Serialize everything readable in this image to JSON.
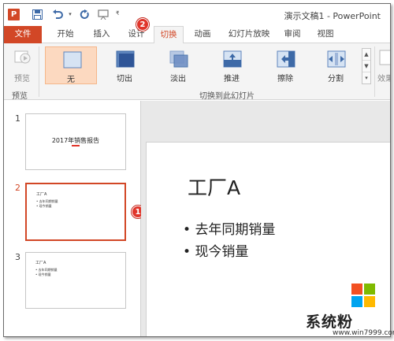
{
  "titlebar": {
    "app_icon": "P",
    "title": "演示文稿1 - PowerPoint",
    "qat": [
      "save-icon",
      "undo-icon",
      "redo-icon",
      "present-icon"
    ]
  },
  "tabs": [
    {
      "label": "文件",
      "active": false
    },
    {
      "label": "开始",
      "active": false
    },
    {
      "label": "插入",
      "active": false
    },
    {
      "label": "设计",
      "active": false
    },
    {
      "label": "切换",
      "active": true
    },
    {
      "label": "动画",
      "active": false
    },
    {
      "label": "幻灯片放映",
      "active": false
    },
    {
      "label": "审阅",
      "active": false
    },
    {
      "label": "视图",
      "active": false
    }
  ],
  "ribbon": {
    "preview_label": "预览",
    "preview_group": "预览",
    "transitions_group": "切换到此幻灯片",
    "transitions": [
      {
        "label": "无",
        "selected": true
      },
      {
        "label": "切出",
        "selected": false
      },
      {
        "label": "淡出",
        "selected": false
      },
      {
        "label": "推进",
        "selected": false
      },
      {
        "label": "擦除",
        "selected": false
      },
      {
        "label": "分割",
        "selected": false
      }
    ],
    "effect_label": "效果"
  },
  "thumbnails": [
    {
      "number": "1",
      "title": "2017年销售报告"
    },
    {
      "number": "2",
      "heading": "工厂A",
      "bullets": [
        "去年同期销量",
        "现今销量"
      ]
    },
    {
      "number": "3",
      "heading": "工厂A",
      "bullets": [
        "去年同期销量",
        "现今销量"
      ]
    }
  ],
  "slide": {
    "title": "工厂A",
    "bullets": [
      "去年同期销量",
      "现今销量"
    ]
  },
  "annotations": {
    "badge1": "1",
    "badge2": "2"
  },
  "watermark": {
    "text": "系统粉",
    "url": "www.win7999.com"
  },
  "colors": {
    "accent": "#d24726",
    "selected_fill": "#fcd9c0",
    "badge": "#e0352a"
  }
}
